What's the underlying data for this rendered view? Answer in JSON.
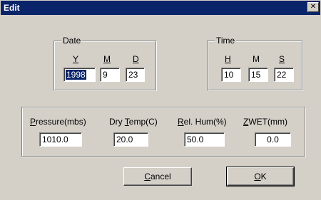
{
  "window": {
    "title": "Edit",
    "close_glyph": "✕"
  },
  "date_group": {
    "legend": "Date",
    "labels": {
      "y_ul": "Y",
      "y_rest": "",
      "m_ul": "M",
      "m_rest": "",
      "d_ul": "D",
      "d_rest": ""
    },
    "values": {
      "year": "1998",
      "month": "9",
      "day": "23"
    }
  },
  "time_group": {
    "legend": "Time",
    "labels": {
      "h_ul": "H",
      "m": "M",
      "s_ul": "S"
    },
    "values": {
      "hour": "10",
      "minute": "15",
      "second": "22"
    }
  },
  "weather_group": {
    "labels": {
      "pressure_ul": "P",
      "pressure_rest": "ressure(mbs)",
      "drytemp_pre": "Dry ",
      "drytemp_ul": "T",
      "drytemp_rest": "emp(C)",
      "relhum_ul": "R",
      "relhum_rest": "el. Hum(%)",
      "zwet_ul": "Z",
      "zwet_rest": "WET(mm)"
    },
    "values": {
      "pressure": "1010.0",
      "dry_temp": "20.0",
      "rel_hum": "50.0",
      "zwet": "0.0"
    }
  },
  "buttons": {
    "cancel_ul": "C",
    "cancel_rest": "ancel",
    "ok_ul": "O",
    "ok_rest": "K"
  }
}
